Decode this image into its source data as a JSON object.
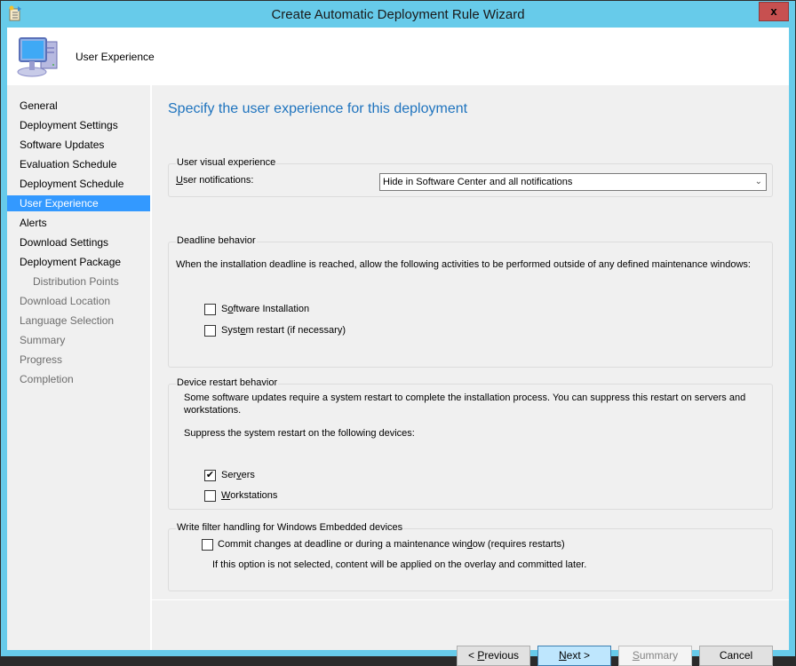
{
  "window": {
    "title": "Create Automatic Deployment Rule Wizard",
    "close_label": "x",
    "header_title": "User Experience"
  },
  "sidebar": {
    "items": [
      {
        "label": "General",
        "state": "normal"
      },
      {
        "label": "Deployment Settings",
        "state": "normal"
      },
      {
        "label": "Software Updates",
        "state": "normal"
      },
      {
        "label": "Evaluation Schedule",
        "state": "normal"
      },
      {
        "label": "Deployment Schedule",
        "state": "normal"
      },
      {
        "label": "User Experience",
        "state": "active"
      },
      {
        "label": "Alerts",
        "state": "normal"
      },
      {
        "label": "Download Settings",
        "state": "normal"
      },
      {
        "label": "Deployment Package",
        "state": "normal"
      },
      {
        "label": "Distribution Points",
        "state": "sub-disabled"
      },
      {
        "label": "Download Location",
        "state": "disabled"
      },
      {
        "label": "Language Selection",
        "state": "disabled"
      },
      {
        "label": "Summary",
        "state": "disabled"
      },
      {
        "label": "Progress",
        "state": "disabled"
      },
      {
        "label": "Completion",
        "state": "disabled"
      }
    ]
  },
  "main": {
    "page_title": "Specify the user experience for this deployment",
    "visual": {
      "group_label": "User visual experience",
      "notifications_label_u": "U",
      "notifications_label_rest": "ser notifications:",
      "notifications_value": "Hide in Software Center and all notifications",
      "chevron": "⌄"
    },
    "deadline": {
      "group_label": "Deadline behavior",
      "description": "When the installation deadline is reached, allow the following activities to be performed outside of any defined maintenance windows:",
      "software_install": {
        "pre": "S",
        "u": "o",
        "post": "ftware Installation",
        "checked": false
      },
      "system_restart": {
        "pre": "Syst",
        "u": "e",
        "post": "m restart (if necessary)",
        "checked": false
      }
    },
    "restart": {
      "group_label": "Device restart behavior",
      "description_line1": "Some software updates require a system restart to complete the installation process. You can suppress this restart on servers and",
      "description_line2": "workstations.",
      "suppress_label": "Suppress the system restart on the following devices:",
      "servers": {
        "pre": "Ser",
        "u": "v",
        "post": "ers",
        "checked": true
      },
      "workstations": {
        "pre": "",
        "u": "W",
        "post": "orkstations",
        "checked": false
      }
    },
    "write_filter": {
      "group_label": "Write filter handling for Windows Embedded devices",
      "commit": {
        "pre": "Commit changes at deadline or during a maintenance win",
        "u": "d",
        "post": "ow (requires restarts)",
        "checked": false
      },
      "note": "If this option is not selected, content will be applied on the overlay and committed later."
    }
  },
  "footer": {
    "previous": {
      "pre": "< ",
      "u": "P",
      "post": "revious"
    },
    "next": {
      "pre": "",
      "u": "N",
      "post": "ext >"
    },
    "summary": {
      "pre": "",
      "u": "S",
      "post": "ummary"
    },
    "cancel": "Cancel"
  },
  "check_glyph": "✔"
}
